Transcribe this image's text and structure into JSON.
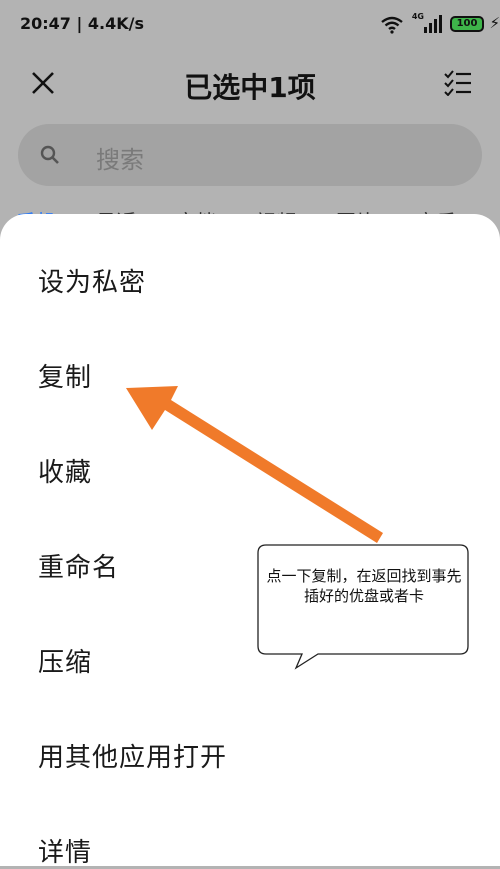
{
  "status_bar": {
    "time_speed": "20:47 | 4.4K/s",
    "network_label": "4G",
    "battery": "100"
  },
  "header": {
    "title": "已选中1项"
  },
  "search": {
    "placeholder": "搜索"
  },
  "tabs": [
    {
      "label": "手机"
    },
    {
      "label": "最近"
    },
    {
      "label": "文档"
    },
    {
      "label": "视频"
    },
    {
      "label": "图片"
    },
    {
      "label": "音乐"
    }
  ],
  "menu": {
    "items": [
      {
        "label": "设为私密"
      },
      {
        "label": "复制"
      },
      {
        "label": "收藏"
      },
      {
        "label": "重命名"
      },
      {
        "label": "压缩"
      },
      {
        "label": "用其他应用打开"
      },
      {
        "label": "详情"
      }
    ]
  },
  "annotation": {
    "callout_text": "点一下复制，在返回找到事先插好的优盘或者卡",
    "arrow_color": "#f07a2a"
  },
  "colors": {
    "overlay": "#b3b3b3",
    "sheet": "#ffffff",
    "battery_fill": "#3eb54a",
    "accent": "#2f7cf6"
  }
}
